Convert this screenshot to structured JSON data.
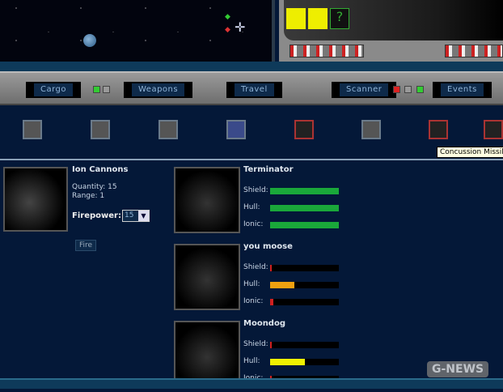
{
  "toolbar": {
    "cargo": "Cargo",
    "weapons": "Weapons",
    "travel": "Travel",
    "scanner": "Scanner",
    "events": "Events"
  },
  "tooltip": "Concussion Missile L",
  "weapon": {
    "name": "Ion Cannons",
    "quantity": "Quantity: 15",
    "range": "Range: 1",
    "firepower_label": "Firepower:",
    "firepower_value": "15",
    "fire": "Fire"
  },
  "targets": [
    {
      "name": "Terminator",
      "shield": 1.0,
      "hull": 1.0,
      "ionic": 1.0
    },
    {
      "name": "you moose",
      "shield": 0.01,
      "hull": 0.35,
      "ionic": 0.05
    },
    {
      "name": "Moondog",
      "shield": 0.01,
      "hull": 0.5,
      "ionic": 0.01
    }
  ],
  "labels": {
    "shield": "Shield:",
    "hull": "Hull:",
    "ionic": "Ionic:"
  },
  "colors": {
    "full": "#1aa83a",
    "orange": "#f0a010",
    "yellow": "#f0f000",
    "red": "#d02020"
  },
  "watermark": "G-NEWS"
}
